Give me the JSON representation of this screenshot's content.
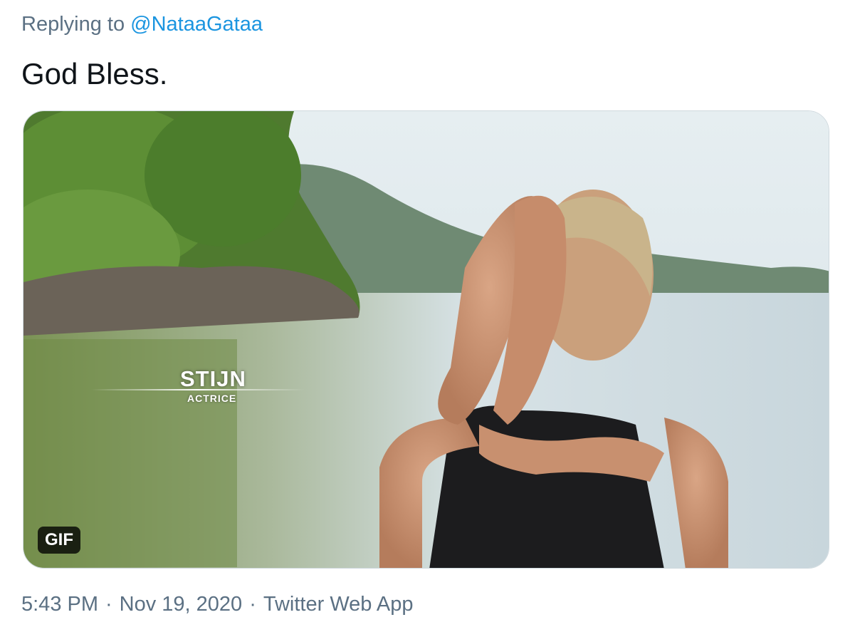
{
  "reply": {
    "prefix": "Replying to",
    "handle": "@NataaGataa"
  },
  "tweet": {
    "text": "God Bless."
  },
  "media": {
    "badge": "GIF",
    "caption_name": "STIJN",
    "caption_sub": "ACTRICE"
  },
  "meta": {
    "time": "5:43 PM",
    "date": "Nov 19, 2020",
    "source": "Twitter Web App"
  },
  "colors": {
    "link": "#1b95e0",
    "muted": "#5b7083",
    "text": "#0f1419"
  }
}
